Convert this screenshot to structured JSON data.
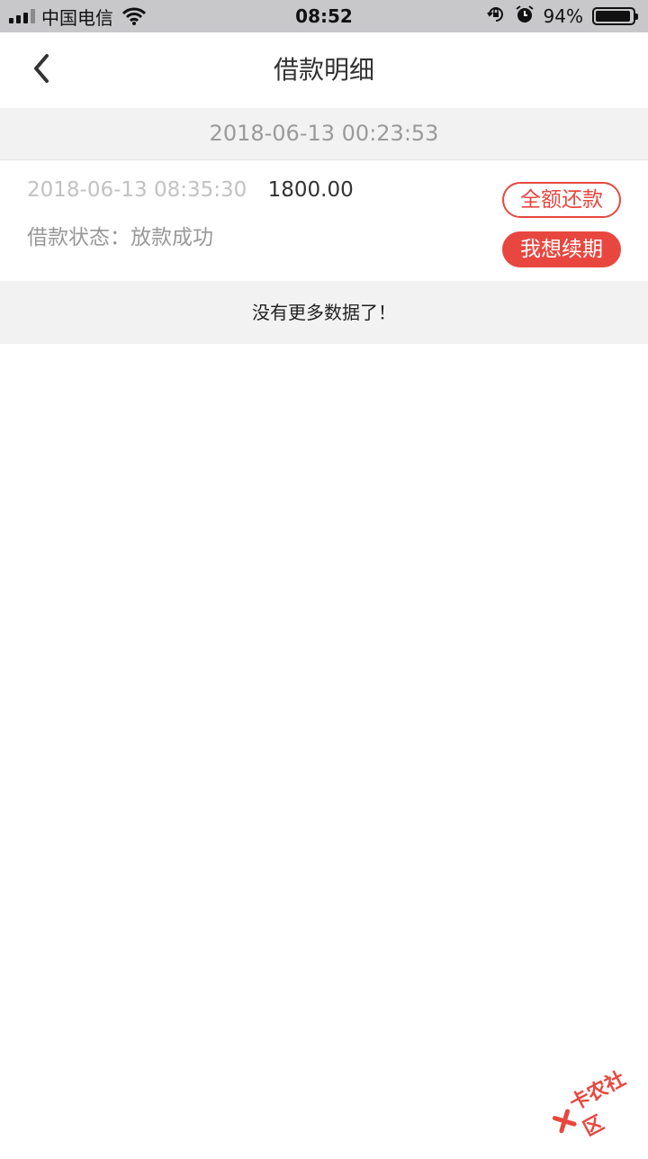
{
  "status_bar": {
    "carrier": "中国电信",
    "time": "08:52",
    "battery_percent": "94%",
    "battery_level": 0.94,
    "signal_bars": 4,
    "signal_active": 3
  },
  "nav": {
    "title": "借款明细",
    "back_icon": "chevron-left-icon"
  },
  "list": {
    "group_date": "2018-06-13 00:23:53",
    "records": [
      {
        "time": "2018-06-13 08:35:30",
        "amount": "1800.00",
        "status": "借款状态：放款成功",
        "full_repay_label": "全额还款",
        "renew_label": "我想续期"
      }
    ],
    "no_more": "没有更多数据了！"
  },
  "watermark": {
    "text": "卡农社区"
  },
  "colors": {
    "accent": "#e8473f",
    "status_bar_bg": "#c8c8cb",
    "section_bg": "#f2f2f2"
  }
}
